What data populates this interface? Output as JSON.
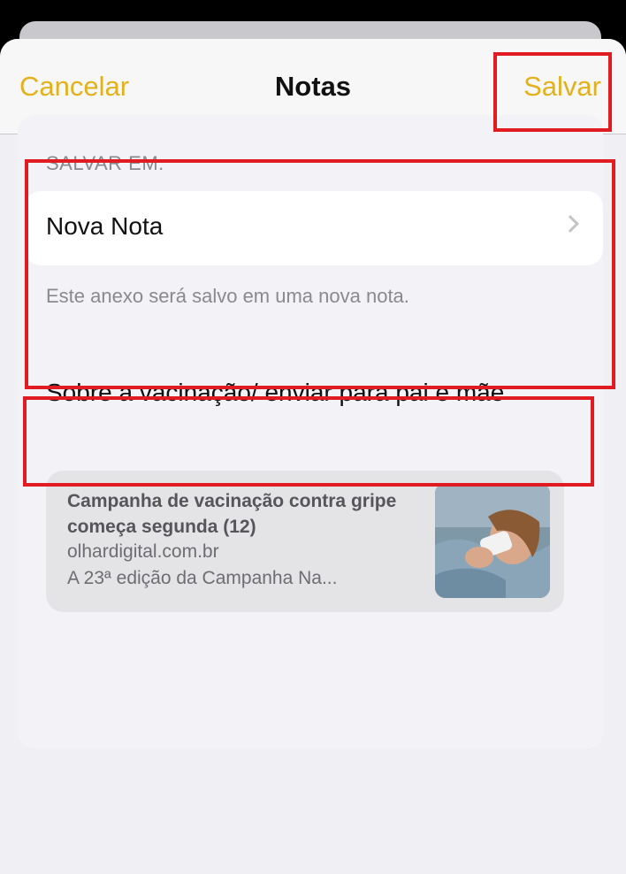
{
  "navbar": {
    "cancel_label": "Cancelar",
    "title": "Notas",
    "save_label": "Salvar"
  },
  "save_to": {
    "header": "SALVAR EM:",
    "destination": "Nova Nota",
    "footer": "Este anexo será salvo em uma nova nota."
  },
  "note": {
    "text": "Sobre a vacinação/ enviar para pai e mãe"
  },
  "link_preview": {
    "title": "Campanha de vacinação contra gripe começa segunda (12)",
    "domain": "olhardigital.com.br",
    "description": "A 23ª edição da Campanha Na..."
  },
  "colors": {
    "accent": "#e3b119",
    "highlight": "#e11b22"
  }
}
